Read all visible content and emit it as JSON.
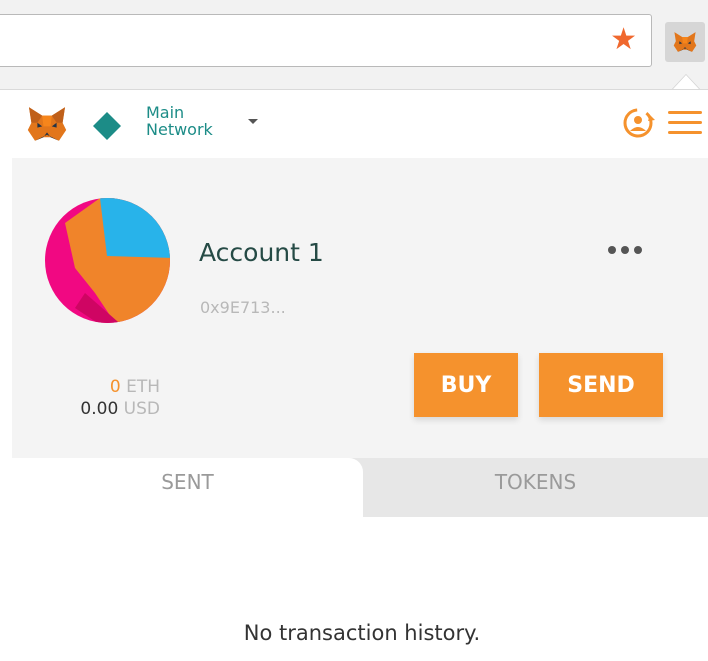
{
  "browser": {
    "bookmark_icon": "star-icon",
    "extension_icon": "metamask-fox-icon",
    "accent_color": "#f0682e"
  },
  "header": {
    "network_name": "Main Network",
    "network_color": "#1c8c87",
    "logo_icon": "metamask-fox-icon",
    "account_switch_icon": "account-switch-icon",
    "menu_icon": "hamburger-icon"
  },
  "account": {
    "name": "Account 1",
    "address": "0x9E713...",
    "menu_icon": "more-dots-icon",
    "balance_eth_value": "0",
    "balance_eth_unit": "ETH",
    "balance_usd_value": "0.00",
    "balance_usd_unit": "USD"
  },
  "actions": {
    "buy_label": "BUY",
    "send_label": "SEND",
    "button_color": "#f5922d"
  },
  "tabs": [
    {
      "label": "SENT",
      "active": true
    },
    {
      "label": "TOKENS",
      "active": false
    }
  ],
  "transactions": {
    "empty_message": "No transaction history."
  }
}
